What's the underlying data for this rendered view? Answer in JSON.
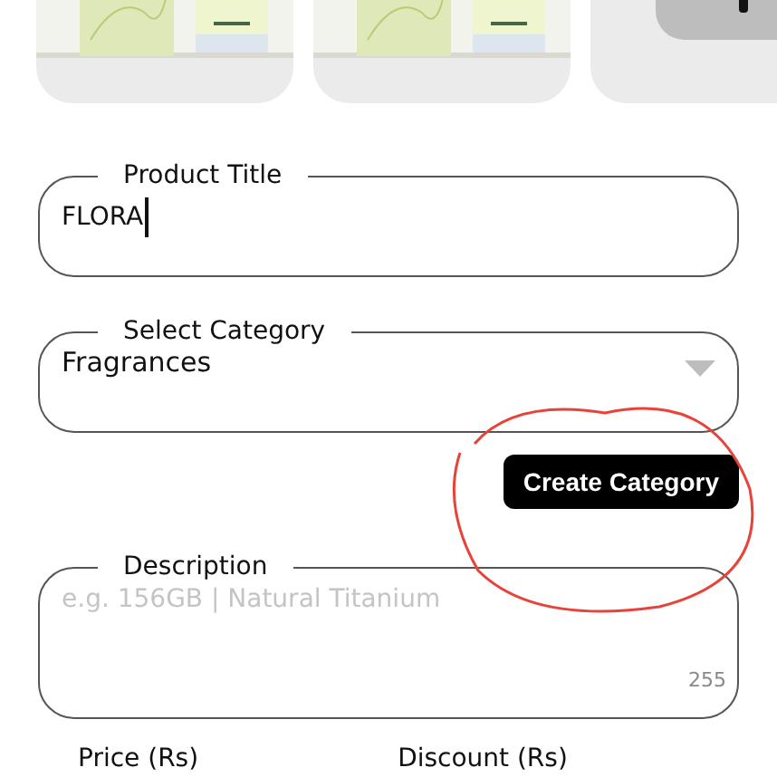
{
  "product_images": [
    {
      "kind": "picture"
    },
    {
      "kind": "picture"
    },
    {
      "kind": "picture"
    }
  ],
  "title_field": {
    "label": "Product Title",
    "value": "FLORA"
  },
  "category_field": {
    "label": "Select Category",
    "value": "Fragrances"
  },
  "create_category_button": "Create Category",
  "description_field": {
    "label": "Description",
    "placeholder": "e.g. 156GB | Natural Titanium",
    "counter": "255"
  },
  "price_labels": [
    "Price (Rs)",
    "Discount (Rs)"
  ]
}
